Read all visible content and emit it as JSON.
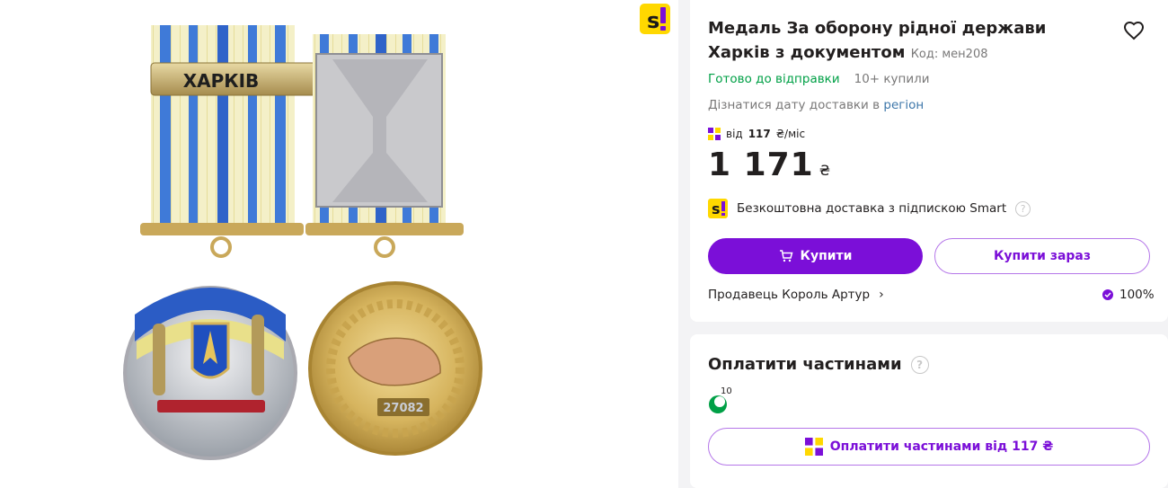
{
  "product": {
    "title": "Медаль За оборону рідної держави Харків з документом",
    "code_label": "Код: мен208",
    "status": "Готово до відправки",
    "bought": "10+ купили",
    "delivery_text": "Дізнатися дату доставки в",
    "delivery_link": "регіон",
    "credit_prefix": "від",
    "credit_amount": "117",
    "credit_suffix": "₴/міс",
    "price": "1 171",
    "currency": "₴",
    "smart_text": "Безкоштовна доставка з підпискою Smart",
    "buy_label": "Купити",
    "buy_now_label": "Купити зараз",
    "seller": "Продавець Король Артур",
    "rating": "100%"
  },
  "images": {
    "bar_text": "ХАРКІВ",
    "medal_number": "27082"
  },
  "parts": {
    "title": "Оплатити частинами",
    "bank_count": "10",
    "button_label": "Оплатити частинами від 117 ₴"
  },
  "colors": {
    "accent": "#7b0fd8",
    "ready": "#00a046",
    "link": "#3e77aa",
    "smart_yellow": "#ffd800"
  },
  "icons": [
    "smart-logo-icon",
    "heart-icon",
    "credit-logo-icon",
    "question-icon",
    "cart-icon",
    "chevron-right-icon",
    "seller-badge-icon",
    "bank-logo-icon"
  ]
}
